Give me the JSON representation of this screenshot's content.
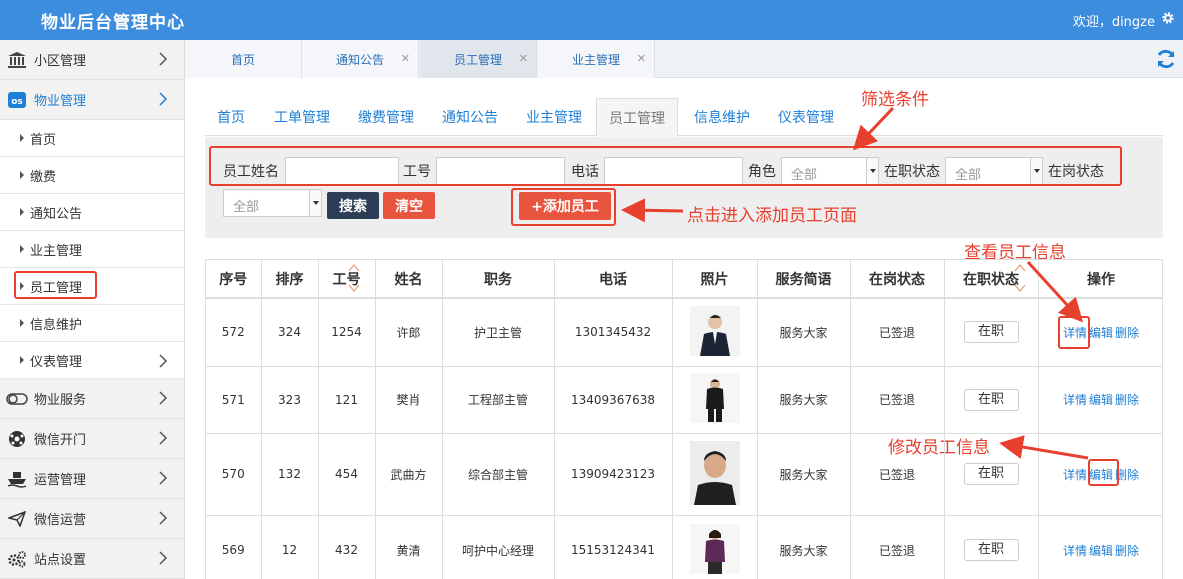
{
  "header": {
    "title": "物业后台管理中心",
    "welcome": "欢迎，dingze"
  },
  "sidebar": {
    "items": [
      {
        "label": "小区管理",
        "icon": "bank-icon"
      },
      {
        "label": "物业管理",
        "icon": "os-icon"
      },
      {
        "label": "物业服务",
        "icon": "toggle-icon"
      },
      {
        "label": "微信开门",
        "icon": "soccer-icon"
      },
      {
        "label": "运营管理",
        "icon": "ship-icon"
      },
      {
        "label": "微信运营",
        "icon": "send-icon"
      },
      {
        "label": "站点设置",
        "icon": "cogs-icon"
      }
    ],
    "sub_items": [
      "首页",
      "缴费",
      "通知公告",
      "业主管理",
      "员工管理",
      "信息维护",
      "仪表管理"
    ]
  },
  "tabs": [
    {
      "label": "首页"
    },
    {
      "label": "通知公告"
    },
    {
      "label": "员工管理"
    },
    {
      "label": "业主管理"
    }
  ],
  "inner_tabs": [
    "首页",
    "工单管理",
    "缴费管理",
    "通知公告",
    "业主管理",
    "员工管理",
    "信息维护",
    "仪表管理"
  ],
  "filter": {
    "name_label": "员工姓名",
    "id_label": "工号",
    "phone_label": "电话",
    "role_label": "角色",
    "role_value": "全部",
    "employ_label": "在职状态",
    "employ_value": "全部",
    "duty_label": "在岗状态",
    "duty_value": "全部",
    "search": "搜索",
    "clear": "清空",
    "add": "+添加员工"
  },
  "annotations": {
    "filter": "筛选条件",
    "add": "点击进入添加员工页面",
    "view": "查看员工信息",
    "edit": "修改员工信息"
  },
  "table": {
    "headers": [
      "序号",
      "排序",
      "工号",
      "姓名",
      "职务",
      "电话",
      "照片",
      "服务简语",
      "在岗状态",
      "在职状态",
      "操作"
    ],
    "ops": {
      "detail": "详情",
      "edit": "编辑",
      "delete": "删除"
    },
    "rows": [
      {
        "no": "572",
        "sort": "324",
        "id": "1254",
        "name": "许郎",
        "title": "护卫主管",
        "phone": "1301345432",
        "motto": "服务大家",
        "duty": "已签退",
        "employ": "在职"
      },
      {
        "no": "571",
        "sort": "323",
        "id": "121",
        "name": "樊肖",
        "title": "工程部主管",
        "phone": "13409367638",
        "motto": "服务大家",
        "duty": "已签退",
        "employ": "在职"
      },
      {
        "no": "570",
        "sort": "132",
        "id": "454",
        "name": "武曲方",
        "title": "综合部主管",
        "phone": "13909423123",
        "motto": "服务大家",
        "duty": "已签退",
        "employ": "在职"
      },
      {
        "no": "569",
        "sort": "12",
        "id": "432",
        "name": "黄清",
        "title": "呵护中心经理",
        "phone": "15153124341",
        "motto": "服务大家",
        "duty": "已签退",
        "employ": "在职"
      }
    ]
  },
  "colors": {
    "topbar": "#3c8dde",
    "link": "#1e7fd6",
    "danger": "#e8402e",
    "dark_button": "#2c3e55"
  }
}
